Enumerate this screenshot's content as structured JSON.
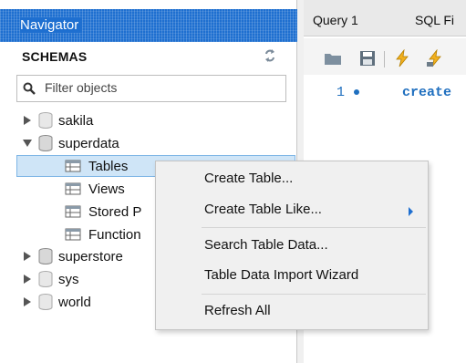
{
  "navigator": {
    "title": "Navigator",
    "schemas_label": "SCHEMAS",
    "filter_placeholder": "Filter objects",
    "tree": [
      {
        "label": "sakila"
      },
      {
        "label": "superdata"
      },
      {
        "label": "Tables"
      },
      {
        "label": "Views"
      },
      {
        "label": "Stored P"
      },
      {
        "label": "Function"
      },
      {
        "label": "superstore"
      },
      {
        "label": "sys"
      },
      {
        "label": "world"
      }
    ]
  },
  "editor": {
    "tabs": [
      "Query 1",
      "SQL Fi"
    ],
    "line_number": "1",
    "code": "create"
  },
  "context_menu": {
    "items": [
      "Create Table...",
      "Create Table Like...",
      "Search Table Data...",
      "Table Data Import Wizard",
      "Refresh All"
    ]
  },
  "colors": {
    "accent": "#1e6fd0",
    "selection": "#cfe5f7",
    "code": "#1f6fbf"
  }
}
